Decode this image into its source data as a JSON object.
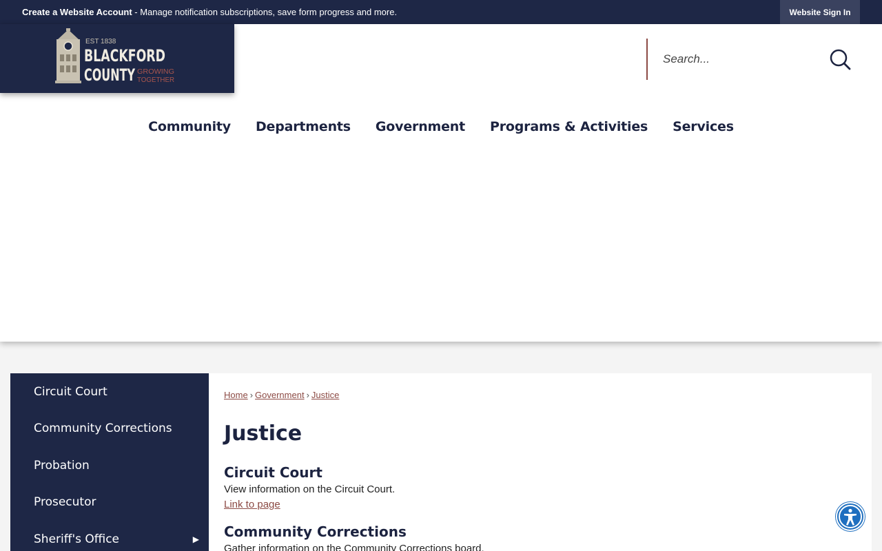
{
  "topbar": {
    "create_account": "Create a Website Account",
    "message": " - Manage notification subscriptions, save form progress and more.",
    "sign_in": "Website Sign In"
  },
  "logo": {
    "est": "EST 1838",
    "line1": "BLACKFORD",
    "line2": "COUNTY",
    "tag1": "GROWING",
    "tag2": "TOGETHER"
  },
  "search": {
    "placeholder": "Search..."
  },
  "nav": [
    "Community",
    "Departments",
    "Government",
    "Programs & Activities",
    "Services"
  ],
  "sidebar": [
    {
      "label": "Circuit Court"
    },
    {
      "label": "Community Corrections"
    },
    {
      "label": "Probation"
    },
    {
      "label": "Prosecutor"
    },
    {
      "label": "Sheriff's Office",
      "arrow": "▶"
    }
  ],
  "breadcrumb": [
    "Home",
    "Government",
    "Justice"
  ],
  "breadcrumb_sep": "›",
  "page_title": "Justice",
  "sections": [
    {
      "title": "Circuit Court",
      "desc": "View information on the Circuit Court.",
      "link": "Link to page"
    },
    {
      "title": "Community Corrections",
      "desc": "Gather information on the Community Corrections board."
    }
  ],
  "colors": {
    "navy": "#1e2746",
    "accent": "#8c4a44",
    "a11y": "#1f6fbf"
  }
}
